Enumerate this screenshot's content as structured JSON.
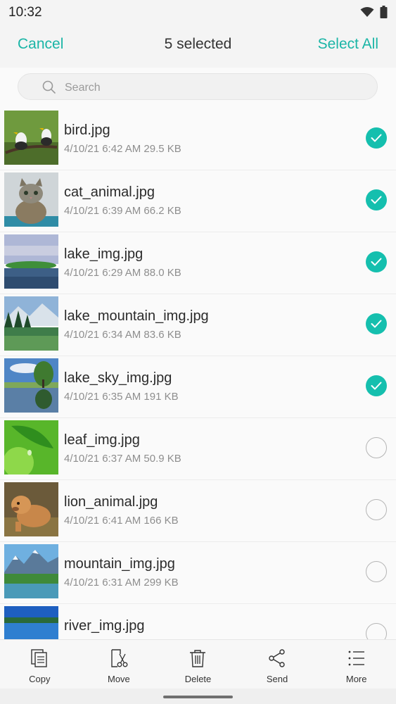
{
  "status_bar": {
    "time": "10:32",
    "icons": [
      "wifi-icon",
      "battery-icon"
    ]
  },
  "action_bar": {
    "cancel_label": "Cancel",
    "title": "5 selected",
    "select_all_label": "Select All"
  },
  "search": {
    "placeholder": "Search",
    "value": ""
  },
  "files": [
    {
      "name": "bird.jpg",
      "meta": "4/10/21 6:42 AM 29.5 KB",
      "selected": true,
      "thumb": "bird"
    },
    {
      "name": "cat_animal.jpg",
      "meta": "4/10/21 6:39 AM 66.2 KB",
      "selected": true,
      "thumb": "cat"
    },
    {
      "name": "lake_img.jpg",
      "meta": "4/10/21 6:29 AM 88.0 KB",
      "selected": true,
      "thumb": "lake"
    },
    {
      "name": "lake_mountain_img.jpg",
      "meta": "4/10/21 6:34 AM 83.6 KB",
      "selected": true,
      "thumb": "lake-mountain"
    },
    {
      "name": "lake_sky_img.jpg",
      "meta": "4/10/21 6:35 AM 191 KB",
      "selected": true,
      "thumb": "lake-sky"
    },
    {
      "name": "leaf_img.jpg",
      "meta": "4/10/21 6:37 AM 50.9 KB",
      "selected": false,
      "thumb": "leaf"
    },
    {
      "name": "lion_animal.jpg",
      "meta": "4/10/21 6:41 AM 166 KB",
      "selected": false,
      "thumb": "lion"
    },
    {
      "name": "mountain_img.jpg",
      "meta": "4/10/21 6:31 AM 299 KB",
      "selected": false,
      "thumb": "mountain"
    },
    {
      "name": "river_img.jpg",
      "meta": "",
      "selected": false,
      "thumb": "river"
    }
  ],
  "toolbar": {
    "copy_label": "Copy",
    "move_label": "Move",
    "delete_label": "Delete",
    "send_label": "Send",
    "more_label": "More"
  },
  "colors": {
    "accent": "#15bfae",
    "accent_text": "#1ab5a6",
    "background": "#f4f4f4"
  }
}
